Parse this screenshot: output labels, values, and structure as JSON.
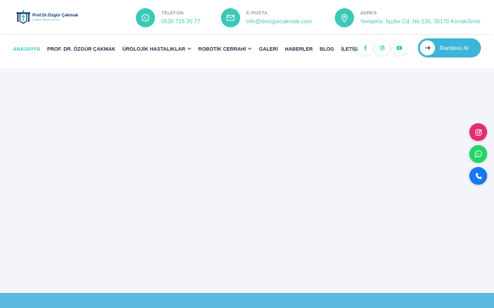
{
  "logo": {
    "name": "Prof.Dr.Özgür Çakmak",
    "subtitle": "Üroloji & Robotik Cerrahi"
  },
  "contacts": [
    {
      "label": "TELEFON",
      "value": "0530 716 35 77",
      "icon": "phone-icon"
    },
    {
      "label": "E-POSTA",
      "value": "info@drozgurcakmak.com",
      "icon": "mail-icon"
    },
    {
      "label": "ADRES",
      "value": "Yenişehir, İşçiler Cd. No:126, 35170 Konak/İzmir",
      "icon": "location-pin-icon"
    }
  ],
  "nav": {
    "items": [
      {
        "label": "ANASAYFA",
        "active": true
      },
      {
        "label": "PROF. DR. ÖZGÜR ÇAKMAK"
      },
      {
        "label": "ÜROLOJİK HASTALIKLAR",
        "dropdown": true
      },
      {
        "label": "ROBOTİK CERRAHİ",
        "dropdown": true
      },
      {
        "label": "GALERİ"
      },
      {
        "label": "HABERLER"
      },
      {
        "label": "BLOG"
      },
      {
        "label": "İLETİŞİM"
      }
    ]
  },
  "socials": [
    "facebook-icon",
    "instagram-icon",
    "youtube-icon"
  ],
  "cta": {
    "label": "Randevu Al",
    "icon": "arrow-right-icon"
  },
  "floating": [
    "instagram-icon",
    "whatsapp-icon",
    "phone-icon"
  ],
  "colors": {
    "accent": "#3cc8b8",
    "button": "#3cb5d8",
    "nav_text": "#1d2a44",
    "instagram": "#e1306c",
    "whatsapp": "#25d366",
    "phone": "#1877f2",
    "footer": "#5ab8e0"
  }
}
